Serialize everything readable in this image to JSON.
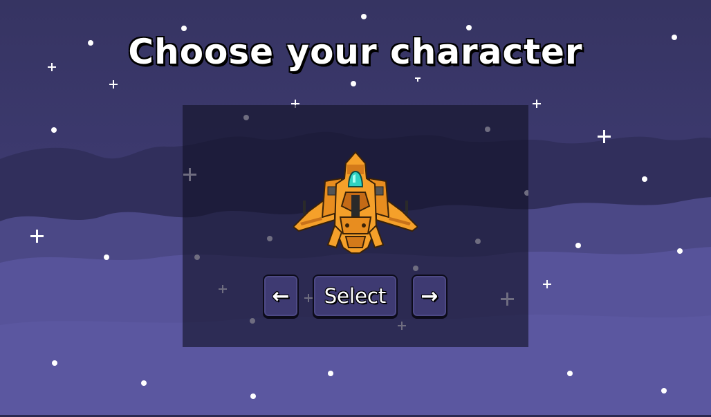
{
  "title": "Choose your character",
  "buttons": {
    "prev_label": "←",
    "select_label": "Select",
    "next_label": "→"
  },
  "character": {
    "icon": "orange-spaceship-icon"
  },
  "colors": {
    "sky_top": "#393766",
    "sky_bottom": "#5c58a0",
    "cloud": "#4a4788",
    "panel": "#16152c",
    "button": "#3e3a72",
    "ship_orange": "#f5a02a",
    "ship_cockpit": "#2fd3c2"
  }
}
